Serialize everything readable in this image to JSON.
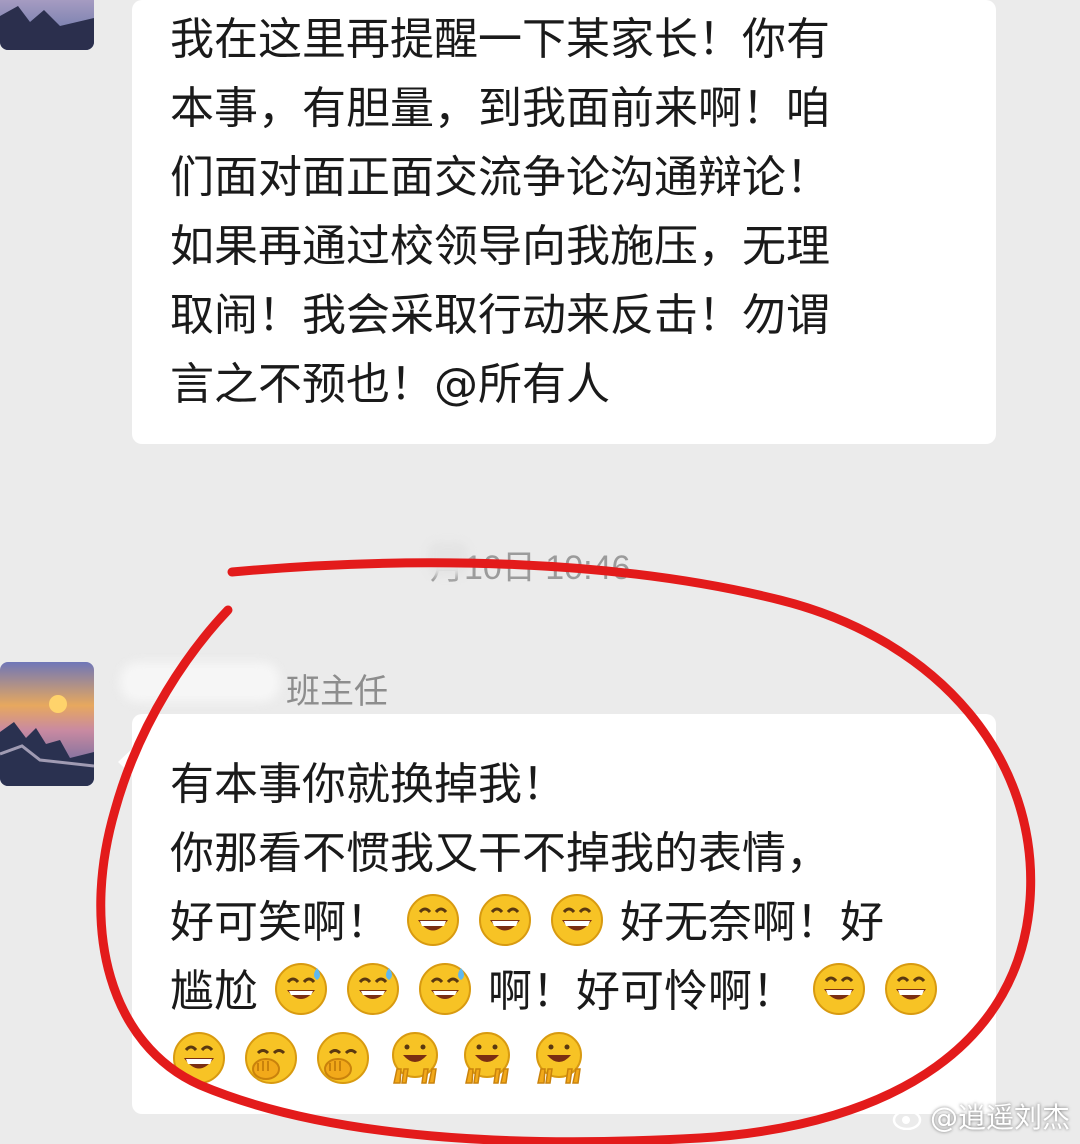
{
  "messages": [
    {
      "lines": [
        "我在这里再提醒一下某家长！你有",
        "本事，有胆量，到我面前来啊！咱",
        "们面对面正面交流争论沟通辩论！",
        "如果再通过校领导向我施压，无理",
        "取闹！我会采取行动来反击！勿谓",
        "言之不预也！@所有人"
      ]
    }
  ],
  "timestamp": "月10日 10:46",
  "sender": {
    "role": "班主任"
  },
  "reply": {
    "line1": "有本事你就换掉我！",
    "line2": "你那看不惯我又干不掉我的表情，",
    "line3_a": "好可笑啊！",
    "line3_b": "好无奈啊！好",
    "line4_a": "尴尬",
    "line4_b": "啊！好可怜啊！"
  },
  "colors": {
    "annotation": "#e31b1b",
    "bubble": "#ffffff",
    "background": "#ebebeb"
  },
  "icons": [
    "grin-emoji",
    "sweat-smile-emoji",
    "face-palm-emoji",
    "peace-emoji",
    "weibo-logo-icon"
  ],
  "watermark": "@逍遥刘杰"
}
